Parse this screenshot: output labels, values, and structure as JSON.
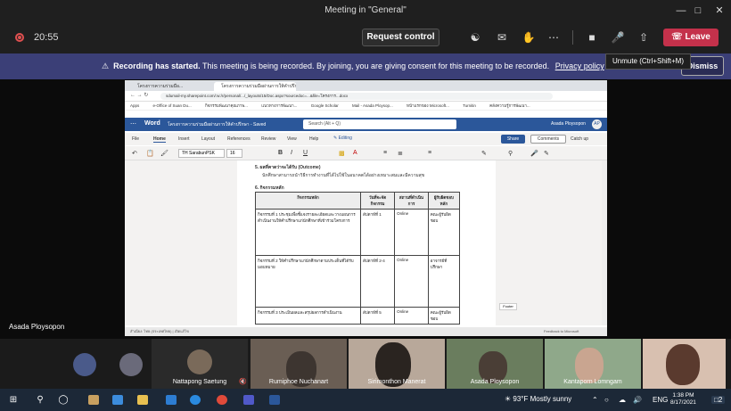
{
  "window": {
    "title": "Meeting in \"General\""
  },
  "call": {
    "timer": "20:55",
    "request_control": "Request control",
    "leave": "Leave",
    "tooltip": "Unmute (Ctrl+Shift+M)"
  },
  "banner": {
    "lead": "Recording has started.",
    "message": "This meeting is being recorded. By joining, you are giving consent for this meeting to be recorded.",
    "link": "Privacy policy",
    "dismiss": "Dismiss"
  },
  "shared": {
    "tabs": [
      "โครงการความร่วมมือ...",
      "โครงการความร่วมมือผ่านการให้คำปรึกษา"
    ],
    "url": "sdumail-my.sharepoint.com/:w:/r/personal/.../_layouts/15/Doc.aspx?sourcedoc=...&file=โครงการ...docx",
    "bookmarks": [
      "Apps",
      "e-Office of Suan Du...",
      "กิจกรรมพัฒนาคุณภาพ...",
      "แนวทางการพัฒนา...",
      "Google Scholar",
      "Mail - Asada Ploysop...",
      "หน้าแรกของ Microsoft...",
      "Turnitin",
      "คลังความรู้การพัฒนา..."
    ],
    "word": {
      "app": "Word",
      "doc_title": "โครงการความร่วมมือผ่านการให้คำปรึกษา - Saved",
      "search": "Search (Alt + Q)",
      "user": "Asada Ploysopon",
      "initials": "AP",
      "menus": [
        "File",
        "Home",
        "Insert",
        "Layout",
        "References",
        "Review",
        "View",
        "Help"
      ],
      "editing": "Editing",
      "share": "Share",
      "comments": "Comments",
      "catchup": "Catch up",
      "font": "TH SarabunPSK",
      "size": "16"
    },
    "doc": {
      "line1": "5. ผลที่คาดว่าจะได้รับ (Outcome)",
      "line2": "นักศึกษาสามารถนำวิธีการทำงานที่ได้ไปใช้ในอนาคตได้อย่างเหมาะสมและมีความสุข",
      "line3": "6. กิจกรรมหลัก",
      "headers": [
        "กิจกรรมหลัก",
        "วันที่จะจัดกิจกรรม",
        "สถานที่ดำเนินการ",
        "ผู้รับผิดชอบหลัก"
      ],
      "rows": [
        [
          "กิจกรรมที่ 1 ประชุมเพื่อชี้แจงรายละเอียดและวางแผนการดำเนินงานให้คำปรึกษาแก่นักศึกษาที่เข้าร่วมโครงการ",
          "สัปดาห์ที่ 1",
          "Online",
          "คณะผู้รับผิดชอบ"
        ],
        [
          "กิจกรรมที่ 2 ให้คำปรึกษาแก่นักศึกษาตามประเด็นที่ได้รับมอบหมาย",
          "สัปดาห์ที่ 2-4",
          "Online",
          "อาจารย์ที่ปรึกษา"
        ],
        [
          "กิจกรรมที่ 3 ประเมินผลและสรุปผลการดำเนินงาน",
          "สัปดาห์ที่ 5",
          "Online",
          "คณะผู้รับผิดชอบ"
        ]
      ],
      "status": "สำเนียง: ไทย (ประเทศไทย) | เปิดแก้ไข",
      "feedback": "Feedback to Microsoft",
      "footer_btn": "Footer"
    }
  },
  "self_name": "Asada Ploysopon",
  "participants": [
    {
      "name": ""
    },
    {
      "name": ""
    },
    {
      "name": "Nattapong Saetung"
    },
    {
      "name": "Rumiphoe Nuchanart"
    },
    {
      "name": "Sirimonthon Manerat"
    },
    {
      "name": "Asada Ploysopon"
    },
    {
      "name": "Kantaporn Lomngam"
    },
    {
      "name": ""
    }
  ],
  "taskbar": {
    "weather_temp": "93°F",
    "weather_desc": "Mostly sunny",
    "lang": "ENG",
    "time": "1:38 PM",
    "date": "8/17/2021",
    "notif": "2"
  },
  "colors": {
    "accent": "#3b3f77",
    "leave": "#c4314b",
    "word": "#2b579a"
  }
}
